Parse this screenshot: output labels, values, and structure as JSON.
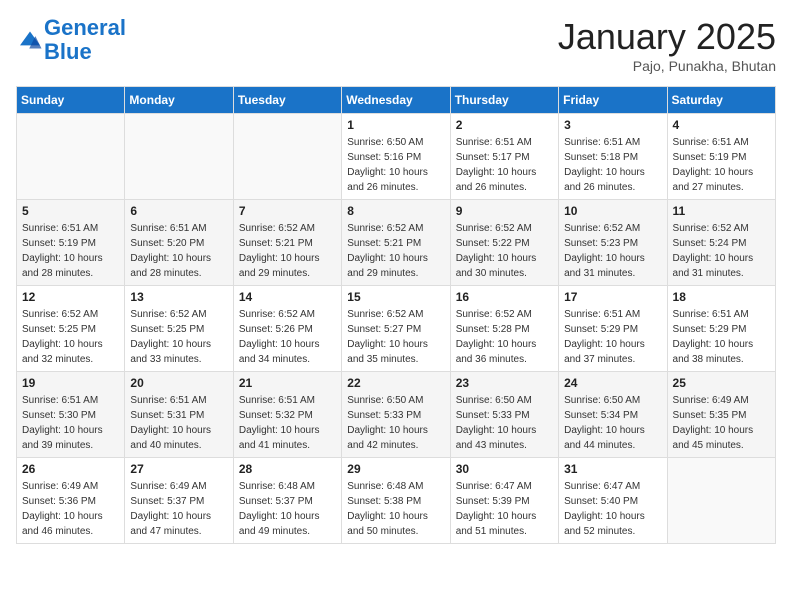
{
  "header": {
    "logo_line1": "General",
    "logo_line2": "Blue",
    "month": "January 2025",
    "location": "Pajo, Punakha, Bhutan"
  },
  "weekdays": [
    "Sunday",
    "Monday",
    "Tuesday",
    "Wednesday",
    "Thursday",
    "Friday",
    "Saturday"
  ],
  "weeks": [
    [
      {
        "day": "",
        "info": ""
      },
      {
        "day": "",
        "info": ""
      },
      {
        "day": "",
        "info": ""
      },
      {
        "day": "1",
        "info": "Sunrise: 6:50 AM\nSunset: 5:16 PM\nDaylight: 10 hours\nand 26 minutes."
      },
      {
        "day": "2",
        "info": "Sunrise: 6:51 AM\nSunset: 5:17 PM\nDaylight: 10 hours\nand 26 minutes."
      },
      {
        "day": "3",
        "info": "Sunrise: 6:51 AM\nSunset: 5:18 PM\nDaylight: 10 hours\nand 26 minutes."
      },
      {
        "day": "4",
        "info": "Sunrise: 6:51 AM\nSunset: 5:19 PM\nDaylight: 10 hours\nand 27 minutes."
      }
    ],
    [
      {
        "day": "5",
        "info": "Sunrise: 6:51 AM\nSunset: 5:19 PM\nDaylight: 10 hours\nand 28 minutes."
      },
      {
        "day": "6",
        "info": "Sunrise: 6:51 AM\nSunset: 5:20 PM\nDaylight: 10 hours\nand 28 minutes."
      },
      {
        "day": "7",
        "info": "Sunrise: 6:52 AM\nSunset: 5:21 PM\nDaylight: 10 hours\nand 29 minutes."
      },
      {
        "day": "8",
        "info": "Sunrise: 6:52 AM\nSunset: 5:21 PM\nDaylight: 10 hours\nand 29 minutes."
      },
      {
        "day": "9",
        "info": "Sunrise: 6:52 AM\nSunset: 5:22 PM\nDaylight: 10 hours\nand 30 minutes."
      },
      {
        "day": "10",
        "info": "Sunrise: 6:52 AM\nSunset: 5:23 PM\nDaylight: 10 hours\nand 31 minutes."
      },
      {
        "day": "11",
        "info": "Sunrise: 6:52 AM\nSunset: 5:24 PM\nDaylight: 10 hours\nand 31 minutes."
      }
    ],
    [
      {
        "day": "12",
        "info": "Sunrise: 6:52 AM\nSunset: 5:25 PM\nDaylight: 10 hours\nand 32 minutes."
      },
      {
        "day": "13",
        "info": "Sunrise: 6:52 AM\nSunset: 5:25 PM\nDaylight: 10 hours\nand 33 minutes."
      },
      {
        "day": "14",
        "info": "Sunrise: 6:52 AM\nSunset: 5:26 PM\nDaylight: 10 hours\nand 34 minutes."
      },
      {
        "day": "15",
        "info": "Sunrise: 6:52 AM\nSunset: 5:27 PM\nDaylight: 10 hours\nand 35 minutes."
      },
      {
        "day": "16",
        "info": "Sunrise: 6:52 AM\nSunset: 5:28 PM\nDaylight: 10 hours\nand 36 minutes."
      },
      {
        "day": "17",
        "info": "Sunrise: 6:51 AM\nSunset: 5:29 PM\nDaylight: 10 hours\nand 37 minutes."
      },
      {
        "day": "18",
        "info": "Sunrise: 6:51 AM\nSunset: 5:29 PM\nDaylight: 10 hours\nand 38 minutes."
      }
    ],
    [
      {
        "day": "19",
        "info": "Sunrise: 6:51 AM\nSunset: 5:30 PM\nDaylight: 10 hours\nand 39 minutes."
      },
      {
        "day": "20",
        "info": "Sunrise: 6:51 AM\nSunset: 5:31 PM\nDaylight: 10 hours\nand 40 minutes."
      },
      {
        "day": "21",
        "info": "Sunrise: 6:51 AM\nSunset: 5:32 PM\nDaylight: 10 hours\nand 41 minutes."
      },
      {
        "day": "22",
        "info": "Sunrise: 6:50 AM\nSunset: 5:33 PM\nDaylight: 10 hours\nand 42 minutes."
      },
      {
        "day": "23",
        "info": "Sunrise: 6:50 AM\nSunset: 5:33 PM\nDaylight: 10 hours\nand 43 minutes."
      },
      {
        "day": "24",
        "info": "Sunrise: 6:50 AM\nSunset: 5:34 PM\nDaylight: 10 hours\nand 44 minutes."
      },
      {
        "day": "25",
        "info": "Sunrise: 6:49 AM\nSunset: 5:35 PM\nDaylight: 10 hours\nand 45 minutes."
      }
    ],
    [
      {
        "day": "26",
        "info": "Sunrise: 6:49 AM\nSunset: 5:36 PM\nDaylight: 10 hours\nand 46 minutes."
      },
      {
        "day": "27",
        "info": "Sunrise: 6:49 AM\nSunset: 5:37 PM\nDaylight: 10 hours\nand 47 minutes."
      },
      {
        "day": "28",
        "info": "Sunrise: 6:48 AM\nSunset: 5:37 PM\nDaylight: 10 hours\nand 49 minutes."
      },
      {
        "day": "29",
        "info": "Sunrise: 6:48 AM\nSunset: 5:38 PM\nDaylight: 10 hours\nand 50 minutes."
      },
      {
        "day": "30",
        "info": "Sunrise: 6:47 AM\nSunset: 5:39 PM\nDaylight: 10 hours\nand 51 minutes."
      },
      {
        "day": "31",
        "info": "Sunrise: 6:47 AM\nSunset: 5:40 PM\nDaylight: 10 hours\nand 52 minutes."
      },
      {
        "day": "",
        "info": ""
      }
    ]
  ]
}
